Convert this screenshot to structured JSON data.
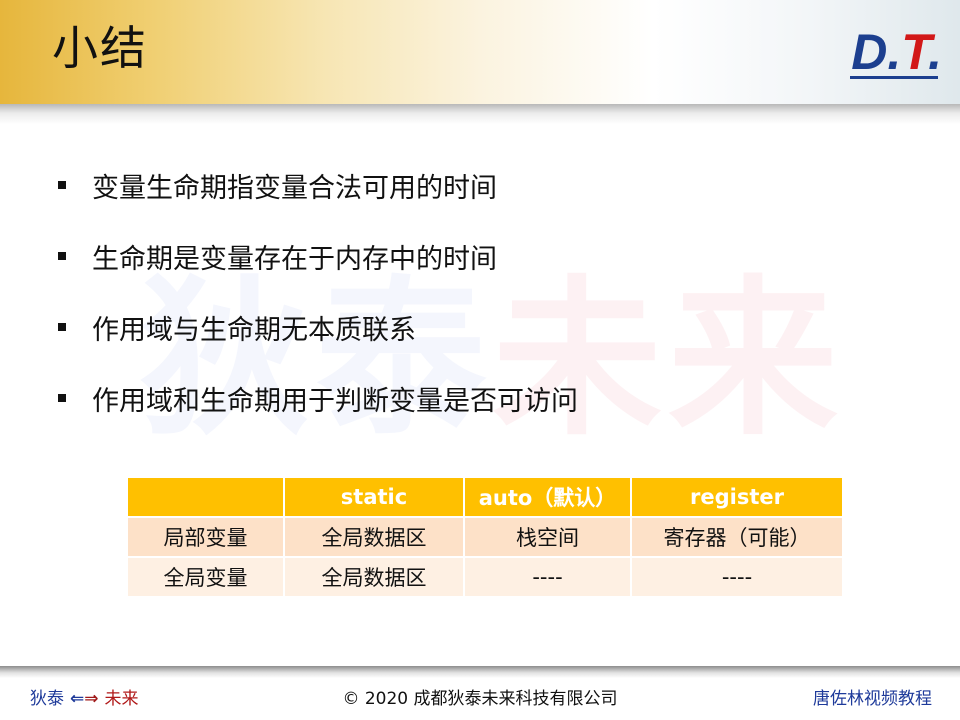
{
  "slide": {
    "title": "小结",
    "logo": {
      "d": "D",
      "dot": ".",
      "t": "T",
      "dot2": "."
    }
  },
  "watermark": {
    "part_a": "狄泰",
    "part_b": "未来"
  },
  "bullets": [
    "变量生命期指变量合法可用的时间",
    "生命期是变量存在于内存中的时间",
    "作用域与生命期无本质联系",
    "作用域和生命期用于判断变量是否可访问"
  ],
  "table": {
    "headers": [
      "",
      "static",
      "auto（默认）",
      "register"
    ],
    "rows": [
      [
        "局部变量",
        "全局数据区",
        "栈空间",
        "寄存器（可能）"
      ],
      [
        "全局变量",
        "全局数据区",
        "----",
        "----"
      ]
    ]
  },
  "footer": {
    "left_a": "狄泰",
    "left_arrow_left": "⇐",
    "left_arrow_right": "⇒",
    "left_b": "未来",
    "center": "© 2020 成都狄泰未来科技有限公司",
    "right": "唐佐林视频教程"
  },
  "colors": {
    "header_gold": "#e6b63c",
    "table_header": "#ffc000",
    "table_row_1": "#fde1c8",
    "table_row_2": "#fef0e3",
    "logo_blue": "#1c3f8f",
    "logo_red": "#d21818"
  }
}
